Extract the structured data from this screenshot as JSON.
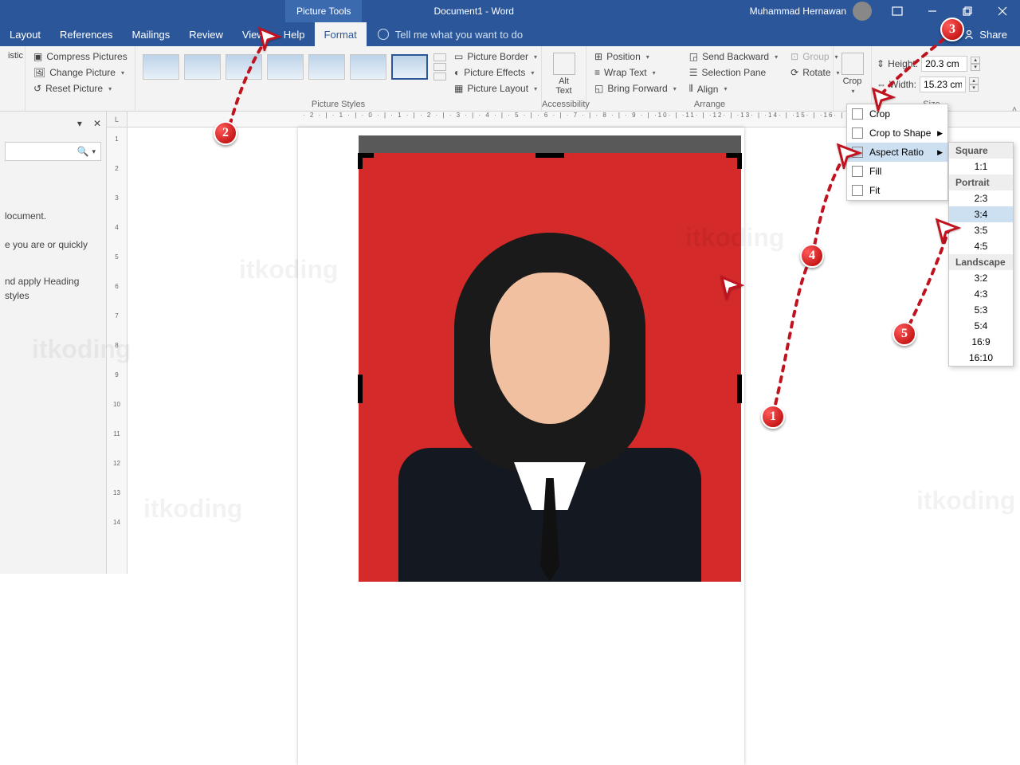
{
  "titlebar": {
    "tools_tab": "Picture Tools",
    "doc_title": "Document1 - Word",
    "user": "Muhammad Hernawan"
  },
  "tabs": {
    "items": [
      "Layout",
      "References",
      "Mailings",
      "Review",
      "View",
      "Help",
      "Format"
    ],
    "tell": "Tell me what you want to do",
    "share": "Share"
  },
  "ribbon": {
    "adjust": {
      "compress": "Compress Pictures",
      "change": "Change Picture",
      "reset": "Reset Picture",
      "artistic": "istic"
    },
    "styles_label": "Picture Styles",
    "border": "Picture Border",
    "effects": "Picture Effects",
    "layout": "Picture Layout",
    "alt_text": "Alt\nText",
    "accessibility": "Accessibility",
    "position": "Position",
    "wrap": "Wrap Text",
    "forward": "Bring Forward",
    "backward": "Send Backward",
    "selpane": "Selection Pane",
    "align": "Align",
    "group": "Group",
    "rotate": "Rotate",
    "arrange": "Arrange",
    "crop": "Crop",
    "height_label": "Height:",
    "height_val": "20.3 cm",
    "width_label": "Width:",
    "width_val": "15.23 cm",
    "size": "Size"
  },
  "crop_menu": {
    "crop": "Crop",
    "shape": "Crop to Shape",
    "aspect": "Aspect Ratio",
    "fill": "Fill",
    "fit": "Fit"
  },
  "aspect": {
    "square": "Square",
    "s11": "1:1",
    "portrait": "Portrait",
    "p23": "2:3",
    "p34": "3:4",
    "p35": "3:5",
    "p45": "4:5",
    "landscape": "Landscape",
    "l32": "3:2",
    "l43": "4:3",
    "l53": "5:3",
    "l54": "5:4",
    "l169": "16:9",
    "l1610": "16:10"
  },
  "navpane": {
    "line1": "locument.",
    "line2": "e you are or quickly",
    "line3": "nd apply Heading styles"
  },
  "markers": {
    "m1": "1",
    "m2": "2",
    "m3": "3",
    "m4": "4",
    "m5": "5"
  },
  "watermark": "itkoding",
  "ruler_h": "· 2 · | · 1 · | · 0 · | · 1 · | · 2 · | · 3 · | · 4 · | · 5 · | · 6 · | · 7 · | · 8 · | · 9 · | ·10· | ·11· | ·12· | ·13· | ·14· | ·15· | ·16· | ·17· | ·18· | ·19·"
}
